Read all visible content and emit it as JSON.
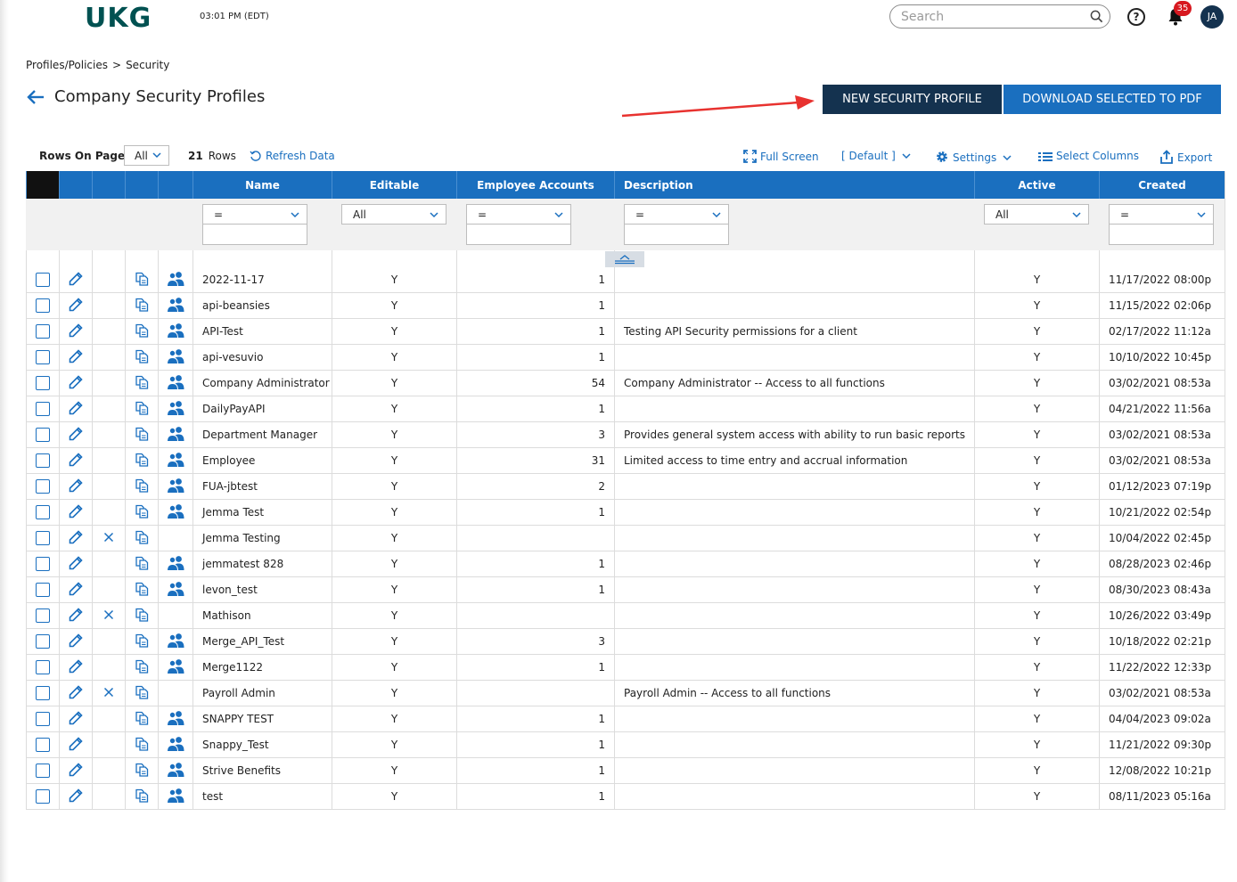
{
  "header": {
    "logo": "UKG",
    "time": "03:01 PM (EDT)",
    "search_placeholder": "Search",
    "notification_count": "35",
    "user_initials": "JA"
  },
  "breadcrumb": {
    "parent": "Profiles/Policies",
    "separator": ">",
    "current": "Security"
  },
  "page": {
    "title": "Company Security Profiles",
    "new_button": "NEW SECURITY PROFILE",
    "download_button": "DOWNLOAD SELECTED TO PDF"
  },
  "toolbar": {
    "rows_on_page_label": "Rows On Page",
    "rows_on_page_value": "All",
    "row_count": "21",
    "rows_label": "Rows",
    "refresh": "Refresh Data",
    "full_screen": "Full Screen",
    "view": "[ Default ]",
    "settings": "Settings",
    "select_columns": "Select Columns",
    "export": "Export"
  },
  "columns": [
    "Name",
    "Editable",
    "Employee Accounts",
    "Description",
    "Active",
    "Created"
  ],
  "filters": {
    "name": "=",
    "editable": "All",
    "employee_accounts": "=",
    "description": "=",
    "active": "All",
    "created": "="
  },
  "rows": [
    {
      "name": "2022-11-17",
      "editable": "Y",
      "accounts": "1",
      "description": "",
      "active": "Y",
      "created": "11/17/2022 08:00p",
      "deletable": false,
      "has_users": true
    },
    {
      "name": "api-beansies",
      "editable": "Y",
      "accounts": "1",
      "description": "",
      "active": "Y",
      "created": "11/15/2022 02:06p",
      "deletable": false,
      "has_users": true
    },
    {
      "name": "API-Test",
      "editable": "Y",
      "accounts": "1",
      "description": "Testing API Security permissions for a client",
      "active": "Y",
      "created": "02/17/2022 11:12a",
      "deletable": false,
      "has_users": true
    },
    {
      "name": "api-vesuvio",
      "editable": "Y",
      "accounts": "1",
      "description": "",
      "active": "Y",
      "created": "10/10/2022 10:45p",
      "deletable": false,
      "has_users": true
    },
    {
      "name": "Company Administrator",
      "editable": "Y",
      "accounts": "54",
      "description": "Company Administrator -- Access to all functions",
      "active": "Y",
      "created": "03/02/2021 08:53a",
      "deletable": false,
      "has_users": true
    },
    {
      "name": "DailyPayAPI",
      "editable": "Y",
      "accounts": "1",
      "description": "",
      "active": "Y",
      "created": "04/21/2022 11:56a",
      "deletable": false,
      "has_users": true
    },
    {
      "name": "Department Manager",
      "editable": "Y",
      "accounts": "3",
      "description": "Provides general system access with ability to run basic reports",
      "active": "Y",
      "created": "03/02/2021 08:53a",
      "deletable": false,
      "has_users": true
    },
    {
      "name": "Employee",
      "editable": "Y",
      "accounts": "31",
      "description": "Limited access to time entry and accrual information",
      "active": "Y",
      "created": "03/02/2021 08:53a",
      "deletable": false,
      "has_users": true
    },
    {
      "name": "FUA-jbtest",
      "editable": "Y",
      "accounts": "2",
      "description": "",
      "active": "Y",
      "created": "01/12/2023 07:19p",
      "deletable": false,
      "has_users": true
    },
    {
      "name": "Jemma Test",
      "editable": "Y",
      "accounts": "1",
      "description": "",
      "active": "Y",
      "created": "10/21/2022 02:54p",
      "deletable": false,
      "has_users": true
    },
    {
      "name": "Jemma Testing",
      "editable": "Y",
      "accounts": "",
      "description": "",
      "active": "Y",
      "created": "10/04/2022 02:45p",
      "deletable": true,
      "has_users": false
    },
    {
      "name": "jemmatest 828",
      "editable": "Y",
      "accounts": "1",
      "description": "",
      "active": "Y",
      "created": "08/28/2023 02:46p",
      "deletable": false,
      "has_users": true
    },
    {
      "name": "levon_test",
      "editable": "Y",
      "accounts": "1",
      "description": "",
      "active": "Y",
      "created": "08/30/2023 08:43a",
      "deletable": false,
      "has_users": true
    },
    {
      "name": "Mathison",
      "editable": "Y",
      "accounts": "",
      "description": "",
      "active": "Y",
      "created": "10/26/2022 03:49p",
      "deletable": true,
      "has_users": false
    },
    {
      "name": "Merge_API_Test",
      "editable": "Y",
      "accounts": "3",
      "description": "",
      "active": "Y",
      "created": "10/18/2022 02:21p",
      "deletable": false,
      "has_users": true
    },
    {
      "name": "Merge1122",
      "editable": "Y",
      "accounts": "1",
      "description": "",
      "active": "Y",
      "created": "11/22/2022 12:33p",
      "deletable": false,
      "has_users": true
    },
    {
      "name": "Payroll Admin",
      "editable": "Y",
      "accounts": "",
      "description": "Payroll Admin -- Access to all functions",
      "active": "Y",
      "created": "03/02/2021 08:53a",
      "deletable": true,
      "has_users": false
    },
    {
      "name": "SNAPPY TEST",
      "editable": "Y",
      "accounts": "1",
      "description": "",
      "active": "Y",
      "created": "04/04/2023 09:02a",
      "deletable": false,
      "has_users": true
    },
    {
      "name": "Snappy_Test",
      "editable": "Y",
      "accounts": "1",
      "description": "",
      "active": "Y",
      "created": "11/21/2022 09:30p",
      "deletable": false,
      "has_users": true
    },
    {
      "name": "Strive Benefits",
      "editable": "Y",
      "accounts": "1",
      "description": "",
      "active": "Y",
      "created": "12/08/2022 10:21p",
      "deletable": false,
      "has_users": true
    },
    {
      "name": "test",
      "editable": "Y",
      "accounts": "1",
      "description": "",
      "active": "Y",
      "created": "08/11/2023 05:16a",
      "deletable": false,
      "has_users": true
    }
  ],
  "colors": {
    "header_blue": "#1a6fbf",
    "navy": "#14324f",
    "logo": "#005151",
    "annotation_arrow": "#e8322f"
  }
}
